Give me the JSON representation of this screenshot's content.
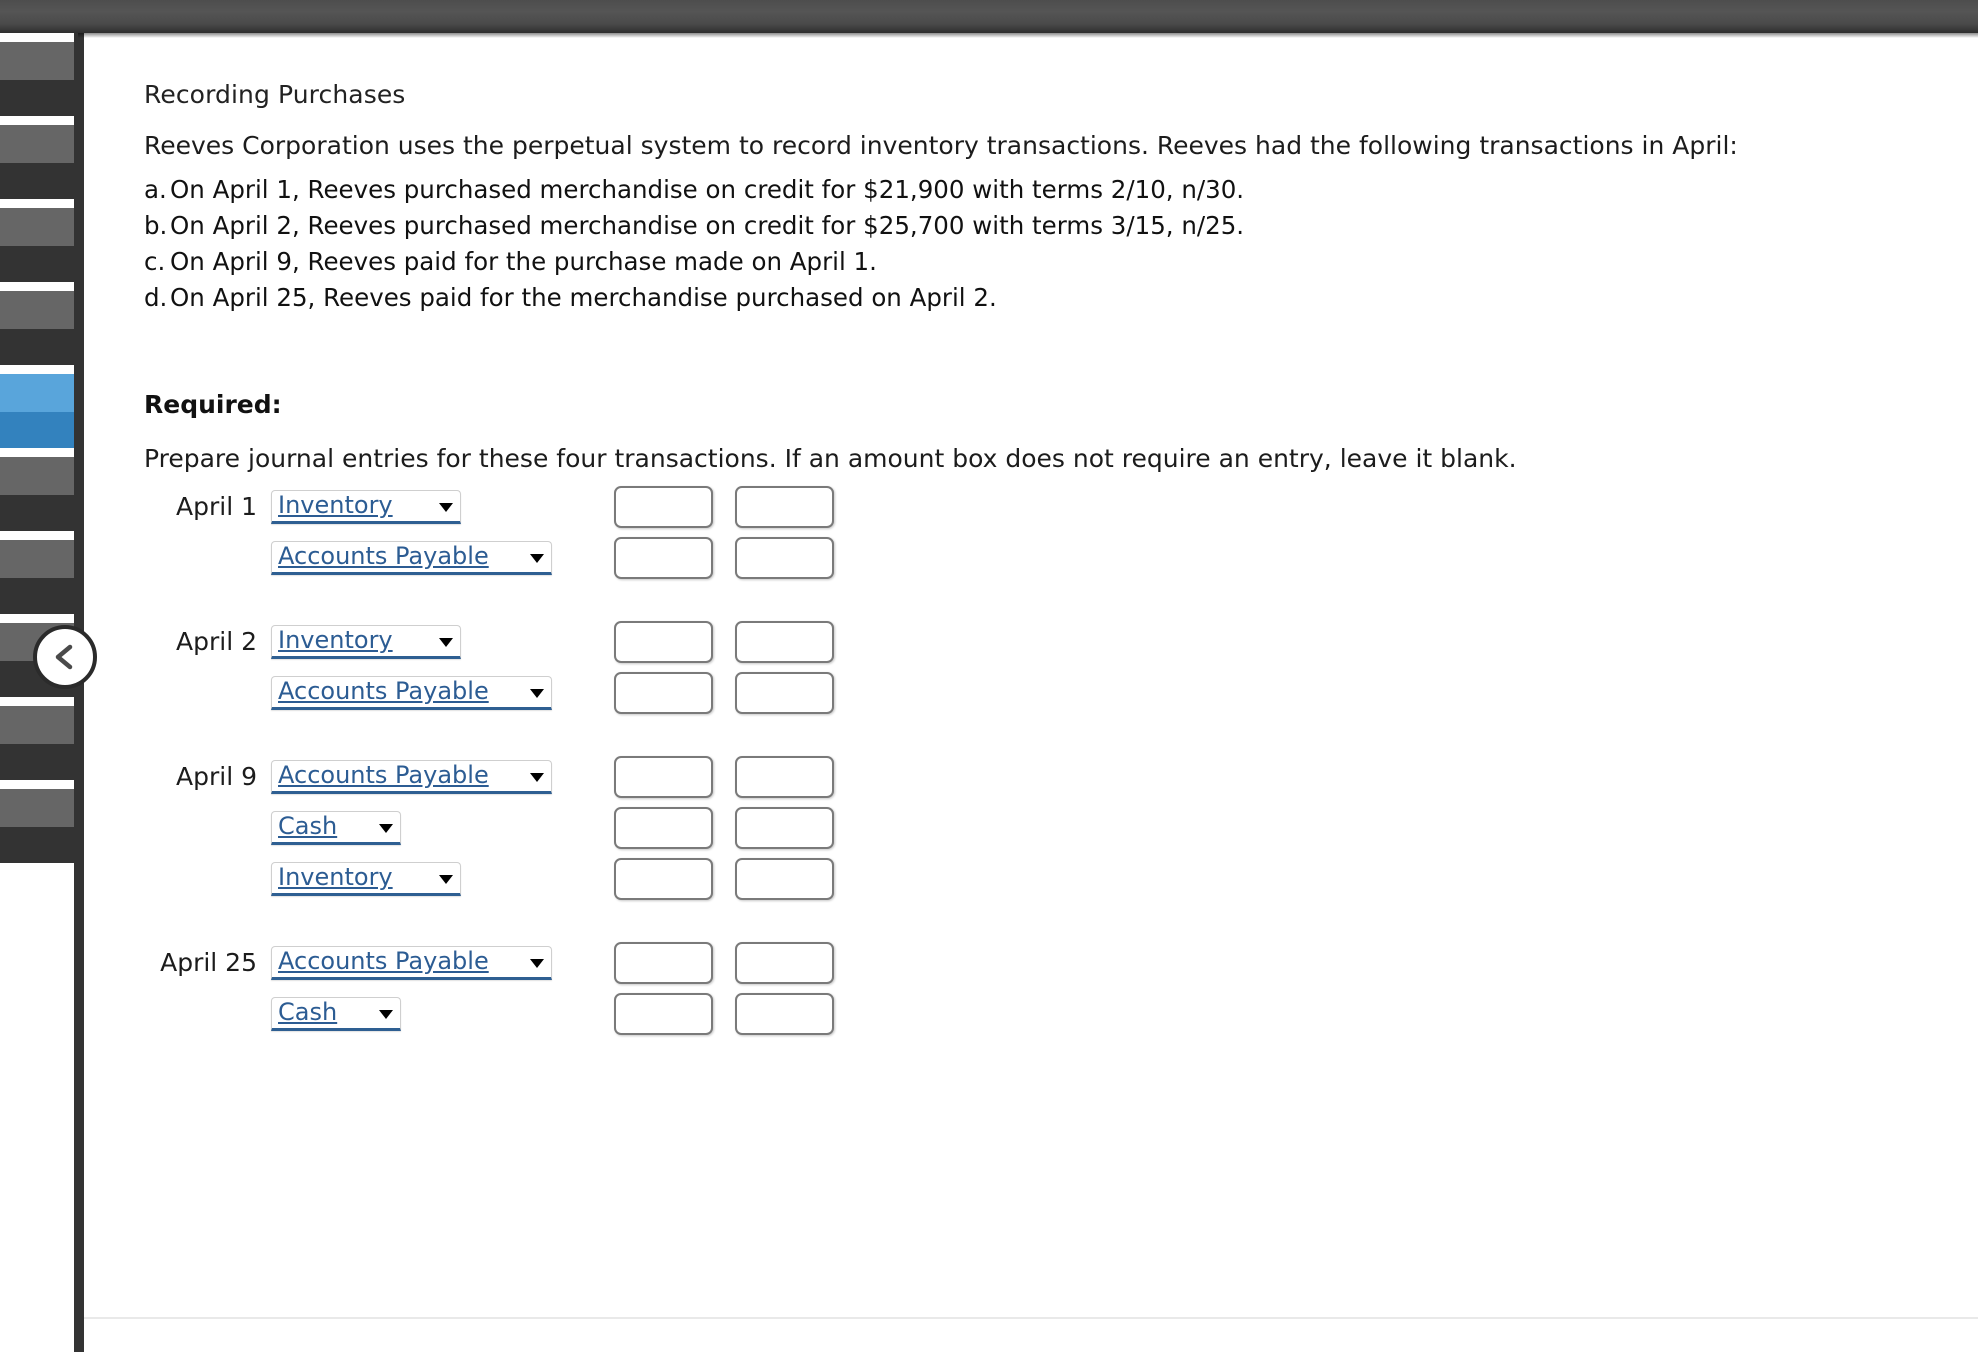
{
  "window": {
    "collapse_button_icon": "chevron-left-icon"
  },
  "sidebar": {
    "thumbnail_count": 10,
    "selected_index": 4
  },
  "main": {
    "page_title": "Recording Purchases",
    "intro": "Reeves Corporation uses the perpetual system to record inventory transactions. Reeves had the following transactions in April:",
    "transactions": [
      {
        "marker": "a.",
        "text": "On April 1, Reeves purchased merchandise on credit for $21,900 with terms 2/10, n/30."
      },
      {
        "marker": "b.",
        "text": "On April 2, Reeves purchased merchandise on credit for $25,700 with terms 3/15, n/25."
      },
      {
        "marker": "c.",
        "text": "On April 9, Reeves paid for the purchase made on April 1."
      },
      {
        "marker": "d.",
        "text": "On April 25, Reeves paid for the merchandise purchased on April 2."
      }
    ],
    "required_label": "Required:",
    "prompt": "Prepare journal entries for these four transactions. If an amount box does not require an entry, leave it blank.",
    "journal": {
      "entries": [
        {
          "date": "April 1",
          "rows": [
            {
              "account": "Inventory",
              "debit": "",
              "credit": ""
            },
            {
              "account": "Accounts Payable",
              "debit": "",
              "credit": ""
            }
          ]
        },
        {
          "date": "April 2",
          "rows": [
            {
              "account": "Inventory",
              "debit": "",
              "credit": ""
            },
            {
              "account": "Accounts Payable",
              "debit": "",
              "credit": ""
            }
          ]
        },
        {
          "date": "April 9",
          "rows": [
            {
              "account": "Accounts Payable",
              "debit": "",
              "credit": ""
            },
            {
              "account": "Cash",
              "debit": "",
              "credit": ""
            },
            {
              "account": "Inventory",
              "debit": "",
              "credit": ""
            }
          ]
        },
        {
          "date": "April 25",
          "rows": [
            {
              "account": "Accounts Payable",
              "debit": "",
              "credit": ""
            },
            {
              "account": "Cash",
              "debit": "",
              "credit": ""
            }
          ]
        }
      ]
    }
  },
  "colors": {
    "select_text": "#2c5c93",
    "select_underline": "#2e5f92",
    "sidebar_selected": "#3382be",
    "top_bar": "#4d4d4d"
  }
}
